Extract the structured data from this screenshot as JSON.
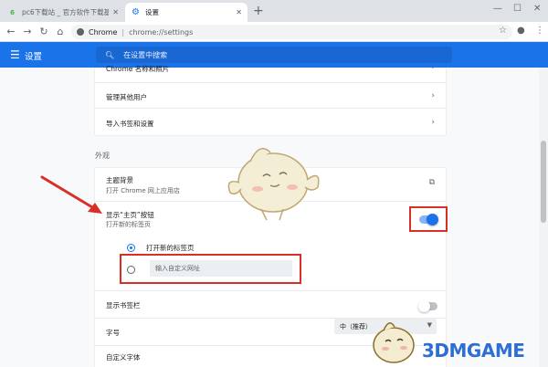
{
  "browser": {
    "tabs": [
      {
        "title": "pc6下载站 _ 官方软件下载基地_",
        "favicon": "6",
        "active": false
      },
      {
        "title": "设置",
        "favicon": "gear-icon",
        "active": true
      }
    ],
    "omnibox": {
      "scheme": "Chrome",
      "url": "chrome://settings"
    }
  },
  "settings_header": {
    "title": "设置",
    "search_placeholder": "在设置中搜索",
    "color": "#1a73e8"
  },
  "people_rows": [
    {
      "label": "Chrome 名称和照片"
    },
    {
      "label": "管理其他用户"
    },
    {
      "label": "导入书签和设置"
    }
  ],
  "appearance": {
    "section_title": "外观",
    "theme": {
      "label": "主题背景",
      "sub": "打开 Chrome 网上应用店"
    },
    "home_button": {
      "label": "显示“主页”按钮",
      "sub": "打开新的标签页",
      "enabled": true
    },
    "home_options": [
      {
        "label": "打开新的标签页",
        "selected": true
      },
      {
        "label": "",
        "selected": false,
        "placeholder": "输入自定义网址"
      }
    ],
    "bookmarks_bar": {
      "label": "显示书签栏",
      "enabled": false
    },
    "font_size": {
      "label": "字号",
      "value": "中（推荐）"
    },
    "custom_fonts": {
      "label": "自定义字体"
    }
  },
  "watermark": "3DMGAME",
  "colors": {
    "accent": "#1a73e8",
    "highlight": "#d93025"
  }
}
